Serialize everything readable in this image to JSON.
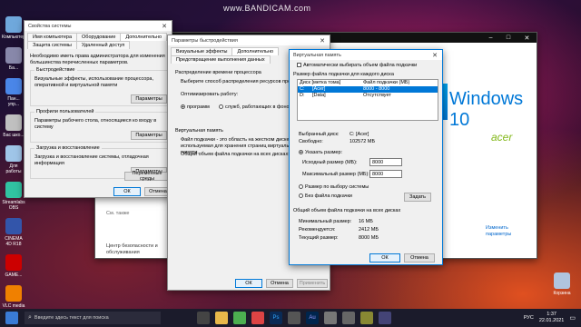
{
  "watermark": "www.BANDICAM.com",
  "desktop_icons": [
    {
      "label": "Компьютер",
      "color": "#6fa8dc"
    },
    {
      "label": "Ба...",
      "color": "#8888aa"
    },
    {
      "label": "Пан... упр...",
      "color": "#4a86e8"
    },
    {
      "label": "Бас шко...",
      "color": "#c0c0c0"
    },
    {
      "label": "Для работы",
      "color": "#9fc5e8"
    },
    {
      "label": "Streamlabs OBS",
      "color": "#31c3a2"
    },
    {
      "label": "CINEMA 4D R18",
      "color": "#3355aa"
    },
    {
      "label": "GAME...",
      "color": "#cc0000"
    },
    {
      "label": "VLC media player",
      "color": "#f08000"
    }
  ],
  "recycle_bin": "Корзина",
  "sysprops": {
    "title": "Свойства системы",
    "tabs": [
      "Имя компьютера",
      "Оборудование",
      "Дополнительно",
      "Защита системы",
      "Удаленный доступ"
    ],
    "intro": "Необходимо иметь права администратора для изменения большинства перечисленных параметров.",
    "perf_title": "Быстродействие",
    "perf_text": "Визуальные эффекты, использование процессора, оперативной и виртуальной памяти",
    "profiles_title": "Профили пользователей",
    "profiles_text": "Параметры рабочего стола, относящиеся ко входу в систему",
    "startup_title": "Загрузка и восстановление",
    "startup_text": "Загрузка и восстановление системы, отладочная информация",
    "params_btn": "Параметры",
    "env_btn": "Переменные среды",
    "ok": "ОК",
    "cancel": "Отмена",
    "apply": "Применить"
  },
  "perfopts": {
    "title": "Параметры быстродействия",
    "tabs": [
      "Визуальные эффекты",
      "Дополнительно",
      "Предотвращение выполнения данных"
    ],
    "cpu_title": "Распределение времени процессора",
    "cpu_text": "Выберите способ распределения ресурсов процессора",
    "optimize": "Оптимизировать работу:",
    "opt_programs": "программ",
    "opt_services": "служб, работающих в фоновом",
    "vm_title": "Виртуальная память",
    "vm_text": "Файл подкачки - это область на жестком диске, используемая для хранения страниц виртуальной памяти.",
    "vm_total": "Общий объем файла подкачки на всех дисках:",
    "ok": "ОК",
    "cancel": "Отмена",
    "apply": "Применить"
  },
  "vm": {
    "title": "Виртуальная память",
    "auto_label": "Автоматически выбирать объем файла подкачки",
    "per_drive": "Размер файла подкачки для каждого диска",
    "col_drive": "Диск [метка тома]",
    "col_size": "Файл подкачки (МБ)",
    "drives": [
      {
        "drive": "C:",
        "label": "[Acer]",
        "size": "8000 - 8000",
        "selected": true
      },
      {
        "drive": "D:",
        "label": "[Data]",
        "size": "Отсутствует",
        "selected": false
      }
    ],
    "selected_disk_label": "Выбранный диск:",
    "selected_disk": "C:  [Acer]",
    "free_label": "Свободно:",
    "free": "102572 МБ",
    "custom": "Указать размер:",
    "initial_label": "Исходный размер (МБ):",
    "initial": "8000",
    "max_label": "Максимальный размер (МБ):",
    "max": "8000",
    "system_managed": "Размер по выбору системы",
    "no_paging": "Без файла подкачки",
    "set_btn": "Задать",
    "total_title": "Общий объем файла подкачки на всех дисках",
    "min_label": "Минимальный размер:",
    "min": "16 МБ",
    "rec_label": "Рекомендуется:",
    "rec": "2412 МБ",
    "cur_label": "Текущий размер:",
    "cur": "8000 МБ",
    "ok": "ОК",
    "cancel": "Отмена"
  },
  "settings_bg": {
    "windows": "Windows 10",
    "acer": "acer",
    "see_also": "См. также",
    "security": "Центр безопасности и обслуживания",
    "rename": "Изменить параметры"
  },
  "taskbar": {
    "search": "Введите здесь текст для поиска",
    "lang": "РУС",
    "time": "1:37",
    "date": "22.01.2021"
  }
}
